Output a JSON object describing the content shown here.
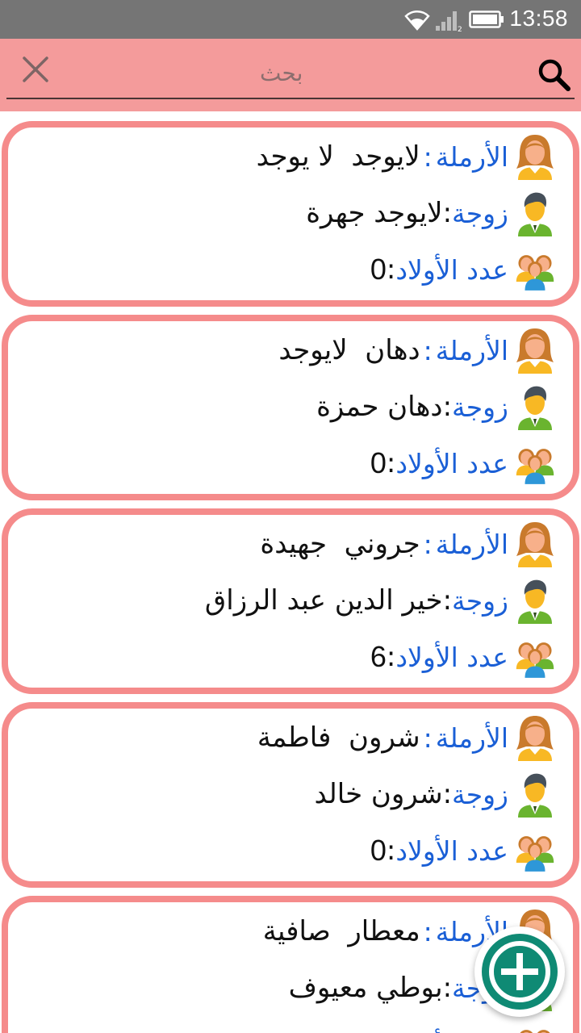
{
  "status_bar": {
    "time": "13:58",
    "icons": [
      "wifi-icon",
      "signal-icon",
      "battery-icon"
    ]
  },
  "search": {
    "placeholder": "بحث",
    "value": "",
    "clear_icon": "close-icon",
    "search_icon": "search-icon"
  },
  "labels": {
    "widow": "الأرملة",
    "husband": "زوجة",
    "children": "عدد الأولاد"
  },
  "records": [
    {
      "widow": "لايوجد  لا يوجد",
      "husband": "لايوجد جهرة",
      "children": "0"
    },
    {
      "widow": "دهان  لايوجد",
      "husband": "دهان حمزة",
      "children": "0"
    },
    {
      "widow": "جروني  جهيدة",
      "husband": "خير الدين عبد الرزاق",
      "children": "6"
    },
    {
      "widow": "شرون  فاطمة",
      "husband": "شرون خالد",
      "children": "0"
    },
    {
      "widow": "معطار  صافية",
      "husband": "بوطي معيوف",
      "children": ""
    }
  ],
  "fab": {
    "icon": "add-icon"
  },
  "colors": {
    "header": "#f49b9b",
    "card_border": "#f58b8b",
    "label": "#1a5fd6",
    "fab": "#0f8a74",
    "status_bar": "#757575"
  }
}
